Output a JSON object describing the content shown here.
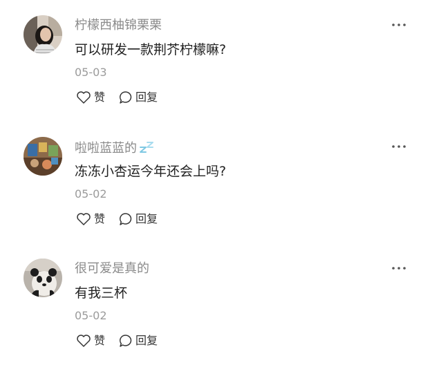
{
  "comments": [
    {
      "user": "柠檬西柚锦栗栗",
      "text": "可以研发一款荆芥柠檬嘛?",
      "date": "05-03",
      "avatar_icon": "avatar-woman-photo",
      "has_badge": false
    },
    {
      "user": "啦啦蓝蓝的",
      "text": "冻冻小杏运今年还会上吗?",
      "date": "05-02",
      "avatar_icon": "avatar-toys-photo",
      "has_badge": true,
      "badge_icon": "sleep-zz-icon"
    },
    {
      "user": "很可爱是真的",
      "text": "有我三杯",
      "date": "05-02",
      "avatar_icon": "avatar-panda-photo",
      "has_badge": false
    }
  ],
  "actions": {
    "like_label": "赞",
    "reply_label": "回复"
  },
  "colors": {
    "username": "#8a8a8a",
    "text": "#1f1f1f",
    "date": "#9b9b9b",
    "action_label": "#333333",
    "badge": "#7ec8e3"
  }
}
